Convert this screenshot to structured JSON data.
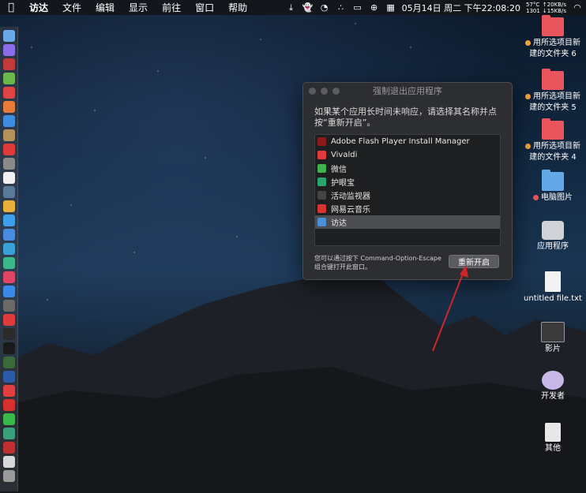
{
  "menubar": {
    "app_name": "访达",
    "menus": [
      "文件",
      "编辑",
      "显示",
      "前往",
      "窗口",
      "帮助"
    ],
    "datetime": "05月14日 周二 下午22:08:20",
    "cpu_temp": "57°C",
    "fan_rpm": "1301",
    "net_up": "↑20KB/s",
    "net_down": "↓15KB/s",
    "tray_icons": [
      "download-icon",
      "ghost-icon",
      "globe-clock-icon",
      "dots-icon",
      "screen-icon",
      "translate-icon",
      "calendar-icon"
    ]
  },
  "dock": {
    "icons": [
      "finder",
      "siri",
      "launchpad",
      "android",
      "app-red",
      "app-mail",
      "safari",
      "note",
      "app-red2",
      "preferences",
      "calendar",
      "app-cube",
      "chrome",
      "qq",
      "app-blue",
      "charts",
      "app-teal",
      "music",
      "appstore",
      "app-gear",
      "vivaldi",
      "terminal",
      "app-black",
      "activity",
      "app-ibm",
      "yandex",
      "netease",
      "wechat",
      "app-green",
      "photo-booth",
      "app-doc",
      "trash"
    ]
  },
  "desktop": [
    {
      "label_line1": "用所选项目新",
      "label_line2": "建的文件夹 6",
      "tag": "orange",
      "type": "folder-red"
    },
    {
      "label_line1": "用所选项目新",
      "label_line2": "建的文件夹 5",
      "tag": "orange",
      "type": "folder-red"
    },
    {
      "label_line1": "用所选项目新",
      "label_line2": "建的文件夹 4",
      "tag": "orange",
      "type": "folder-red"
    },
    {
      "label_line1": "电脑图片",
      "label_line2": "",
      "tag": "red",
      "type": "folder-blue"
    },
    {
      "label_line1": "应用程序",
      "label_line2": "",
      "tag": "",
      "type": "disk"
    },
    {
      "label_line1": "untitled file.txt",
      "label_line2": "",
      "tag": "",
      "type": "txt"
    },
    {
      "label_line1": "影片",
      "label_line2": "",
      "tag": "",
      "type": "film"
    },
    {
      "label_line1": "开发者",
      "label_line2": "",
      "tag": "",
      "type": "dev"
    },
    {
      "label_line1": "其他",
      "label_line2": "",
      "tag": "",
      "type": "other"
    }
  ],
  "force_quit": {
    "title": "强制退出应用程序",
    "prompt_line1": "如果某个应用长时间未响应，请选择其名称并点",
    "prompt_line2": "按“重新开启”。",
    "apps": [
      {
        "name": "Adobe Flash Player Install Manager",
        "color": "#8b1a1a"
      },
      {
        "name": "Vivaldi",
        "color": "#e03a3a"
      },
      {
        "name": "微信",
        "color": "#3fb34f"
      },
      {
        "name": "护眼宝",
        "color": "#2aa36a"
      },
      {
        "name": "活动监视器",
        "color": "#444444"
      },
      {
        "name": "网易云音乐",
        "color": "#d8342f"
      },
      {
        "name": "访达",
        "color": "#4a90d9"
      }
    ],
    "selected_index": 6,
    "hint_line1": "您可以通过按下 Command-Option-Escape",
    "hint_line2": "组合键打开此窗口。",
    "button_label": "重新开启"
  },
  "colors": {
    "annotation_arrow": "#d0232b",
    "dock_bg": "#3c424a"
  }
}
